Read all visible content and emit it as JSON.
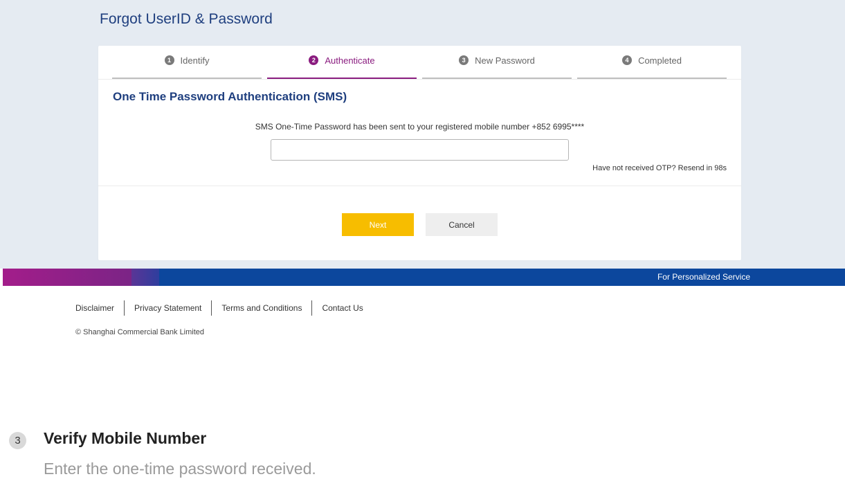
{
  "page": {
    "title": "Forgot UserID & Password"
  },
  "steps": [
    {
      "num": "1",
      "label": "Identify",
      "active": false
    },
    {
      "num": "2",
      "label": "Authenticate",
      "active": true
    },
    {
      "num": "3",
      "label": "New Password",
      "active": false
    },
    {
      "num": "4",
      "label": "Completed",
      "active": false
    }
  ],
  "otp": {
    "section_title": "One Time Password Authentication (SMS)",
    "message": "SMS One-Time Password has been sent to your registered mobile number +852 6995****",
    "input_value": "",
    "resend_text": "Have not received OTP? Resend in 98s"
  },
  "actions": {
    "next_label": "Next",
    "cancel_label": "Cancel"
  },
  "banner": {
    "text": "For Personalized Service"
  },
  "footer": {
    "links": [
      "Disclaimer",
      "Privacy Statement",
      "Terms and Conditions",
      "Contact Us"
    ],
    "copyright": "© Shanghai Commercial Bank Limited"
  },
  "caption": {
    "step_number": "3",
    "title": "Verify Mobile Number",
    "description": "Enter the one-time password received."
  },
  "colors": {
    "accent_purple": "#8a1c7f",
    "title_blue": "#1f3f7f",
    "next_button": "#f7bd00",
    "banner_blue": "#0c479d",
    "background": "#e5ebf2"
  }
}
